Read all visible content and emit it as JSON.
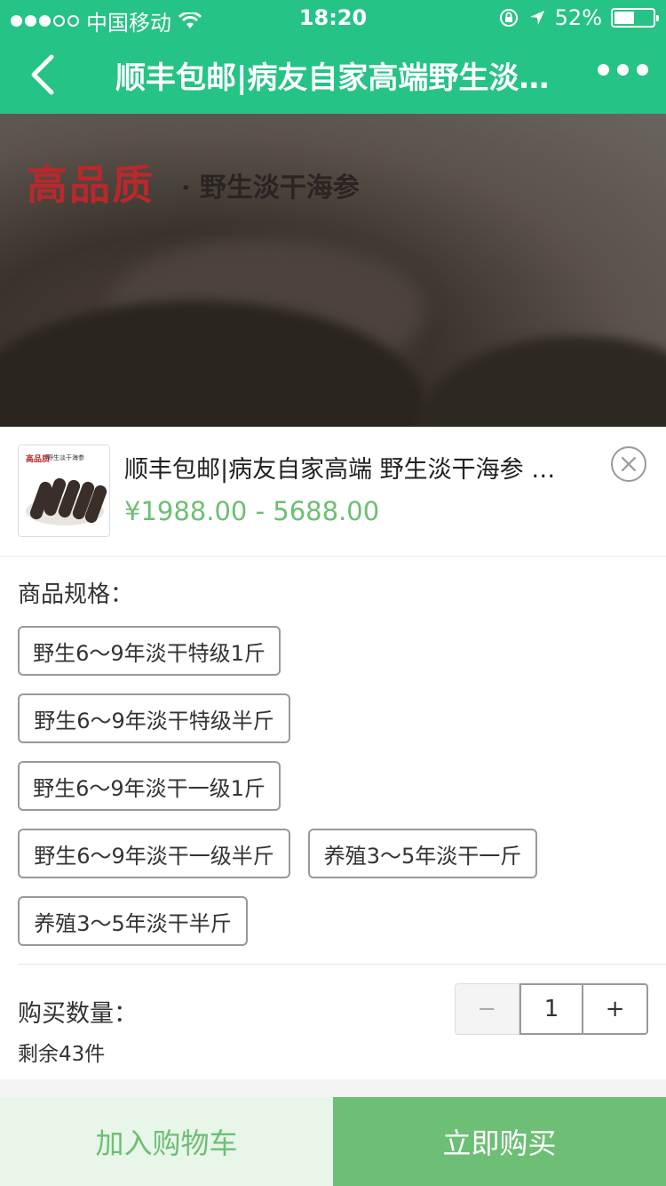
{
  "status_bar": {
    "carrier": "中国移动",
    "time": "18:20",
    "battery_text": "52%",
    "battery_level": 0.52
  },
  "nav": {
    "title": "顺丰包邮|病友自家高端野生淡干海参 纯野生 无添加 特价促销"
  },
  "hero": {
    "brand_text": "高品质",
    "subtitle": "· 野生淡干海参"
  },
  "product": {
    "thumb_brand": "高品质",
    "thumb_sub": "野生淡干海参",
    "title": "顺丰包邮|病友自家高端 野生淡干海参 纯野生 无添加",
    "price": "¥1988.00 - 5688.00"
  },
  "spec": {
    "label": "商品规格：",
    "options": [
      "野生6～9年淡干特级1斤",
      "野生6～9年淡干特级半斤",
      "野生6～9年淡干一级1斤",
      "野生6～9年淡干一级半斤",
      "养殖3～5年淡干一斤",
      "养殖3～5年淡干半斤"
    ]
  },
  "quantity": {
    "label": "购买数量：",
    "remaining": "剩余43件",
    "minus": "−",
    "value": "1",
    "plus": "+"
  },
  "actions": {
    "add_to_cart": "加入购物车",
    "buy_now": "立即购买"
  },
  "colors": {
    "primary": "#26c386",
    "accent": "#6cbf74",
    "cart_bg": "#e8f5e9"
  }
}
